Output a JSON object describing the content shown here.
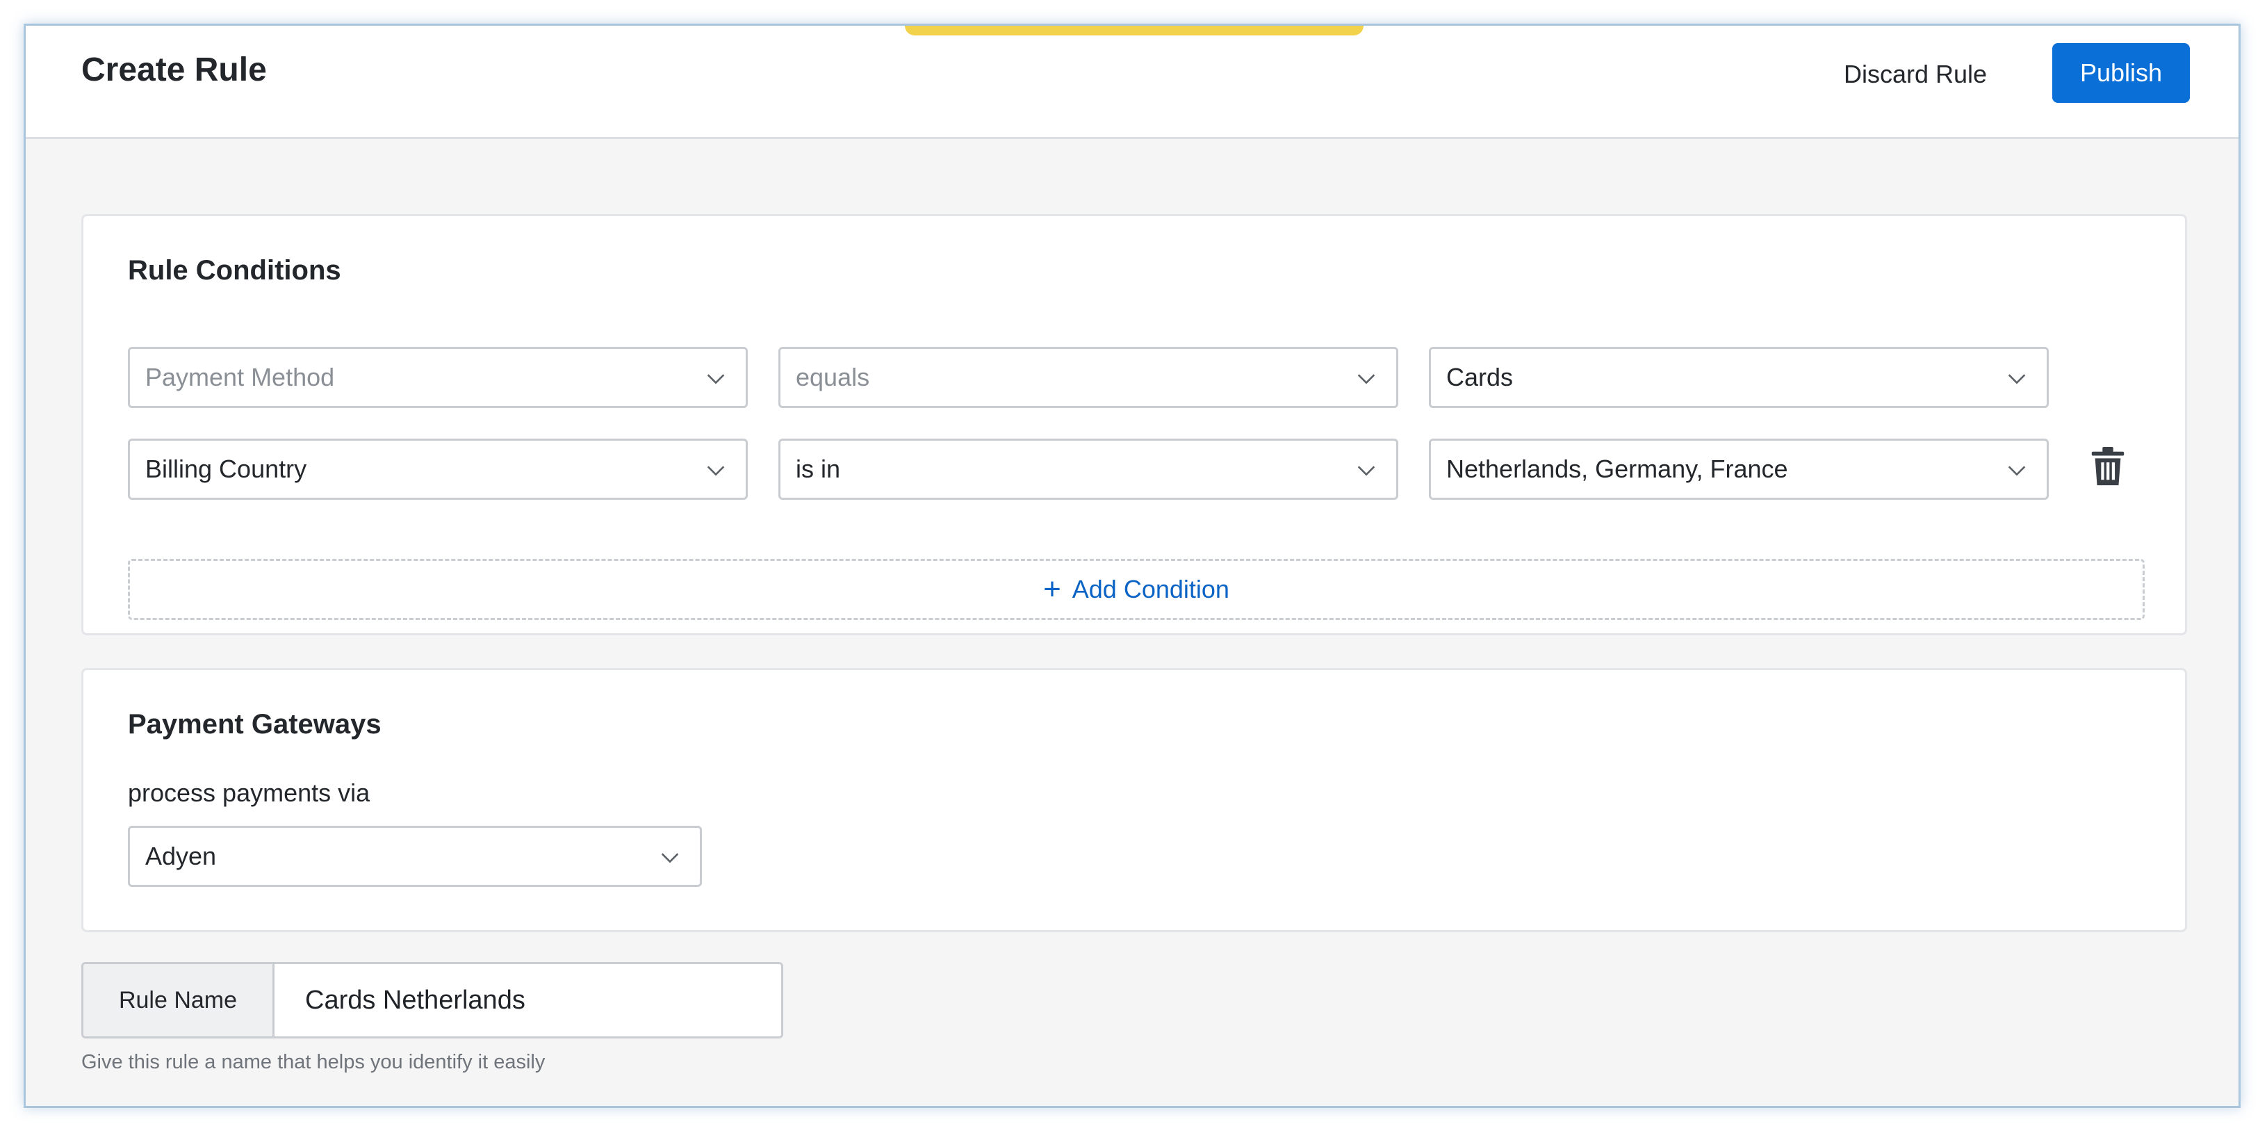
{
  "header": {
    "title": "Create Rule",
    "discard_label": "Discard Rule",
    "publish_label": "Publish",
    "accent_color": "#0b6fd8"
  },
  "conditions": {
    "title": "Rule Conditions",
    "rows": [
      {
        "field": "Payment Method",
        "operator": "equals",
        "value": "Cards"
      },
      {
        "field": "Billing Country",
        "operator": "is in",
        "value": "Netherlands, Germany, France"
      }
    ],
    "add_label": "Add Condition",
    "delete_icon": "trash-icon"
  },
  "gateways": {
    "title": "Payment Gateways",
    "subtitle": "process payments via",
    "selected": "Adyen"
  },
  "rule_name": {
    "label": "Rule Name",
    "value": "Cards Netherlands",
    "helper": "Give this rule a name that helps you identify it easily"
  }
}
